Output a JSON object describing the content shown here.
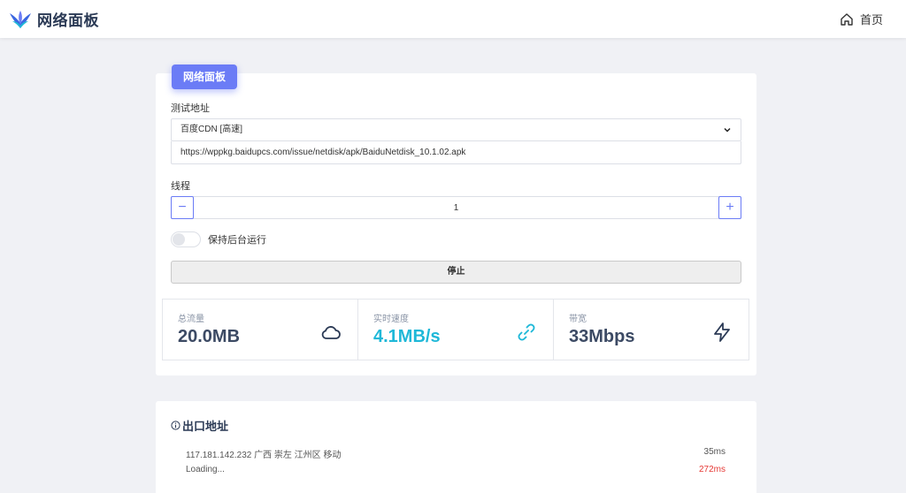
{
  "header": {
    "title": "网络面板",
    "home_label": "首页"
  },
  "panel": {
    "badge": "网络面板",
    "test_address_label": "测试地址",
    "selected_source": "百度CDN [高速]",
    "url": "https://wppkg.baidupcs.com/issue/netdisk/apk/BaiduNetdisk_10.1.02.apk",
    "threads_label": "线程",
    "threads_value": "1",
    "decrement": "−",
    "increment": "+",
    "background_label": "保持后台运行",
    "background_enabled": false,
    "stop_label": "停止"
  },
  "stats": [
    {
      "label": "总流量",
      "value": "20.0MB",
      "icon": "cloud-icon",
      "color": "#3c4a64"
    },
    {
      "label": "实时速度",
      "value": "4.1MB/s",
      "icon": "link-icon",
      "color": "#1fb8d8"
    },
    {
      "label": "带宽",
      "value": "33Mbps",
      "icon": "lightning-icon",
      "color": "#3c4a64"
    }
  ],
  "exit": {
    "title": "出口地址",
    "rows": [
      {
        "address": "117.181.142.232 广西 崇左 江州区 移动",
        "latency": "35ms",
        "status": "ok"
      },
      {
        "address": "Loading...",
        "latency": "272ms",
        "status": "bad"
      }
    ]
  },
  "colors": {
    "accent": "#6b7cf6",
    "speed": "#1fb8d8",
    "danger": "#e53935"
  }
}
